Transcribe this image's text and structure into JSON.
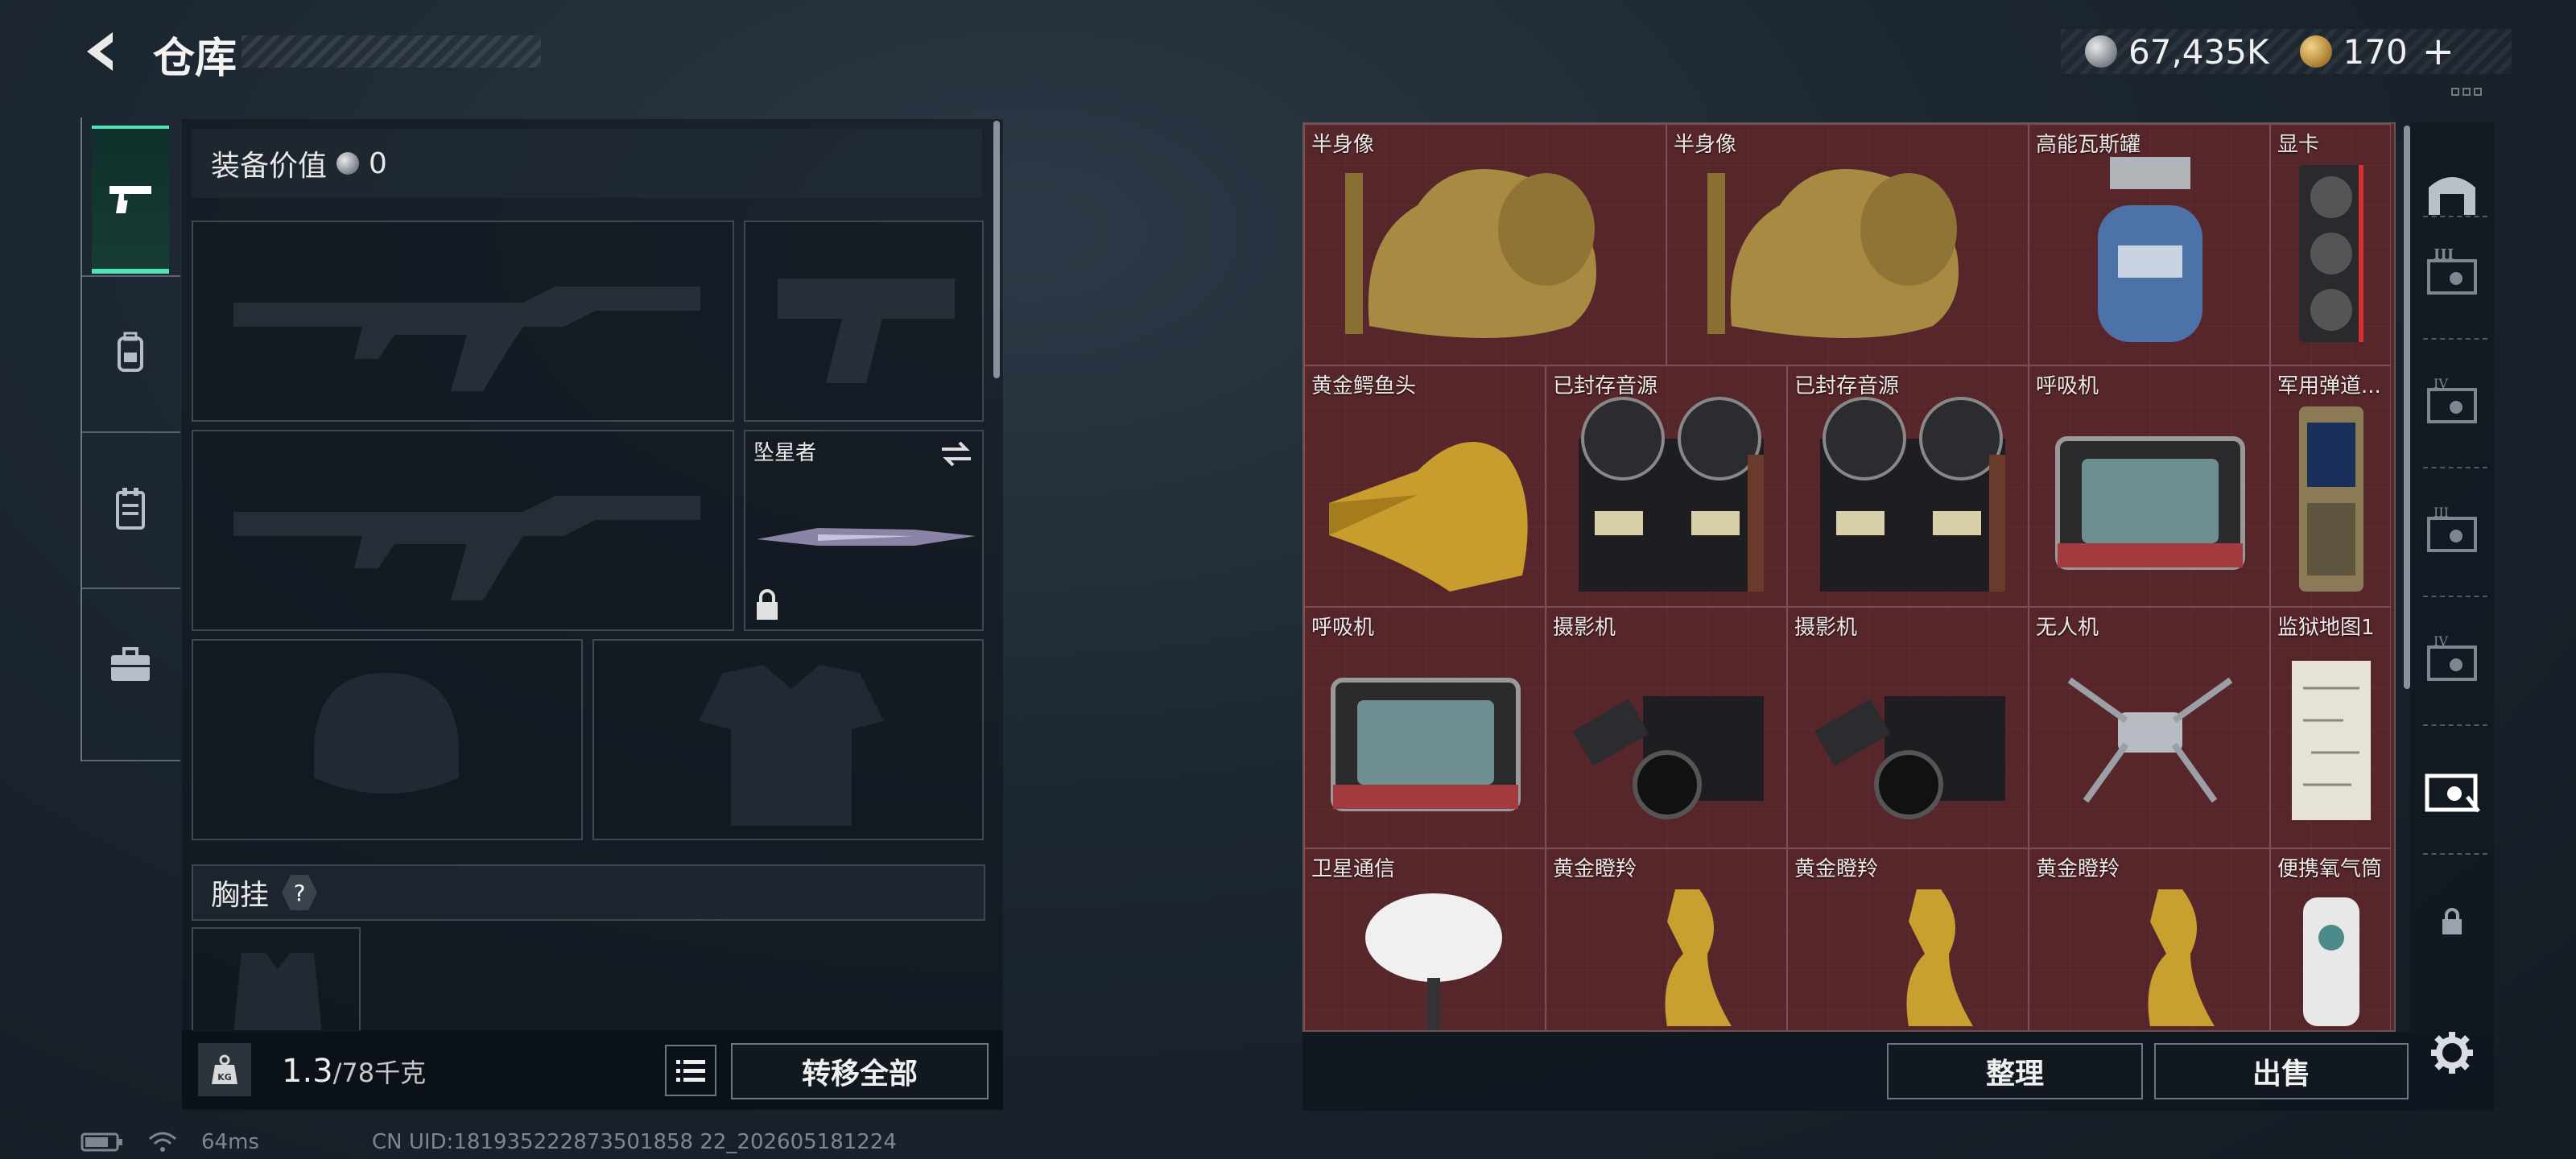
{
  "header": {
    "back_label": "back",
    "title": "仓库"
  },
  "currency": {
    "silver_value": "67,435K",
    "gold_value": "170",
    "gold_add_label": "+"
  },
  "side_tabs": [
    {
      "name": "weapons",
      "icon": "pistol-icon",
      "active": true
    },
    {
      "name": "backpack",
      "icon": "backpack-icon",
      "active": false
    },
    {
      "name": "chest-rig",
      "icon": "vest-icon",
      "active": false
    },
    {
      "name": "case",
      "icon": "briefcase-icon",
      "active": false
    }
  ],
  "equipment": {
    "value_label": "装备价值",
    "value": "0",
    "melee_name": "坠星者",
    "chest_label": "胸挂",
    "chest_help": "?"
  },
  "left_footer": {
    "weight_current": "1.3",
    "weight_max": "/78千克",
    "transfer_all_label": "转移全部"
  },
  "storage_items": [
    {
      "name": "半身像"
    },
    {
      "name": "半身像"
    },
    {
      "name": "高能瓦斯罐"
    },
    {
      "name": "显卡"
    },
    {
      "name": "黄金鳄鱼头"
    },
    {
      "name": "已封存音源"
    },
    {
      "name": "已封存音源"
    },
    {
      "name": "呼吸机"
    },
    {
      "name": "军用弹道..."
    },
    {
      "name": "呼吸机"
    },
    {
      "name": "摄影机"
    },
    {
      "name": "摄影机"
    },
    {
      "name": "无人机"
    },
    {
      "name": "监狱地图1"
    },
    {
      "name": "卫星通信"
    },
    {
      "name": "黄金瞪羚"
    },
    {
      "name": "黄金瞪羚"
    },
    {
      "name": "黄金瞪羚"
    },
    {
      "name": "便携氧气筒"
    }
  ],
  "right_footer": {
    "sort_label": "整理",
    "sell_label": "出售"
  },
  "category_rail": {
    "tiers": [
      "III",
      "IV",
      "III",
      "IV"
    ]
  },
  "status_bar": {
    "ping": "64ms",
    "uid": "CN UID:181935222873501858 22_202605181224"
  },
  "colors": {
    "accent": "#4fe3b8",
    "storage_bg": "#56272a"
  }
}
